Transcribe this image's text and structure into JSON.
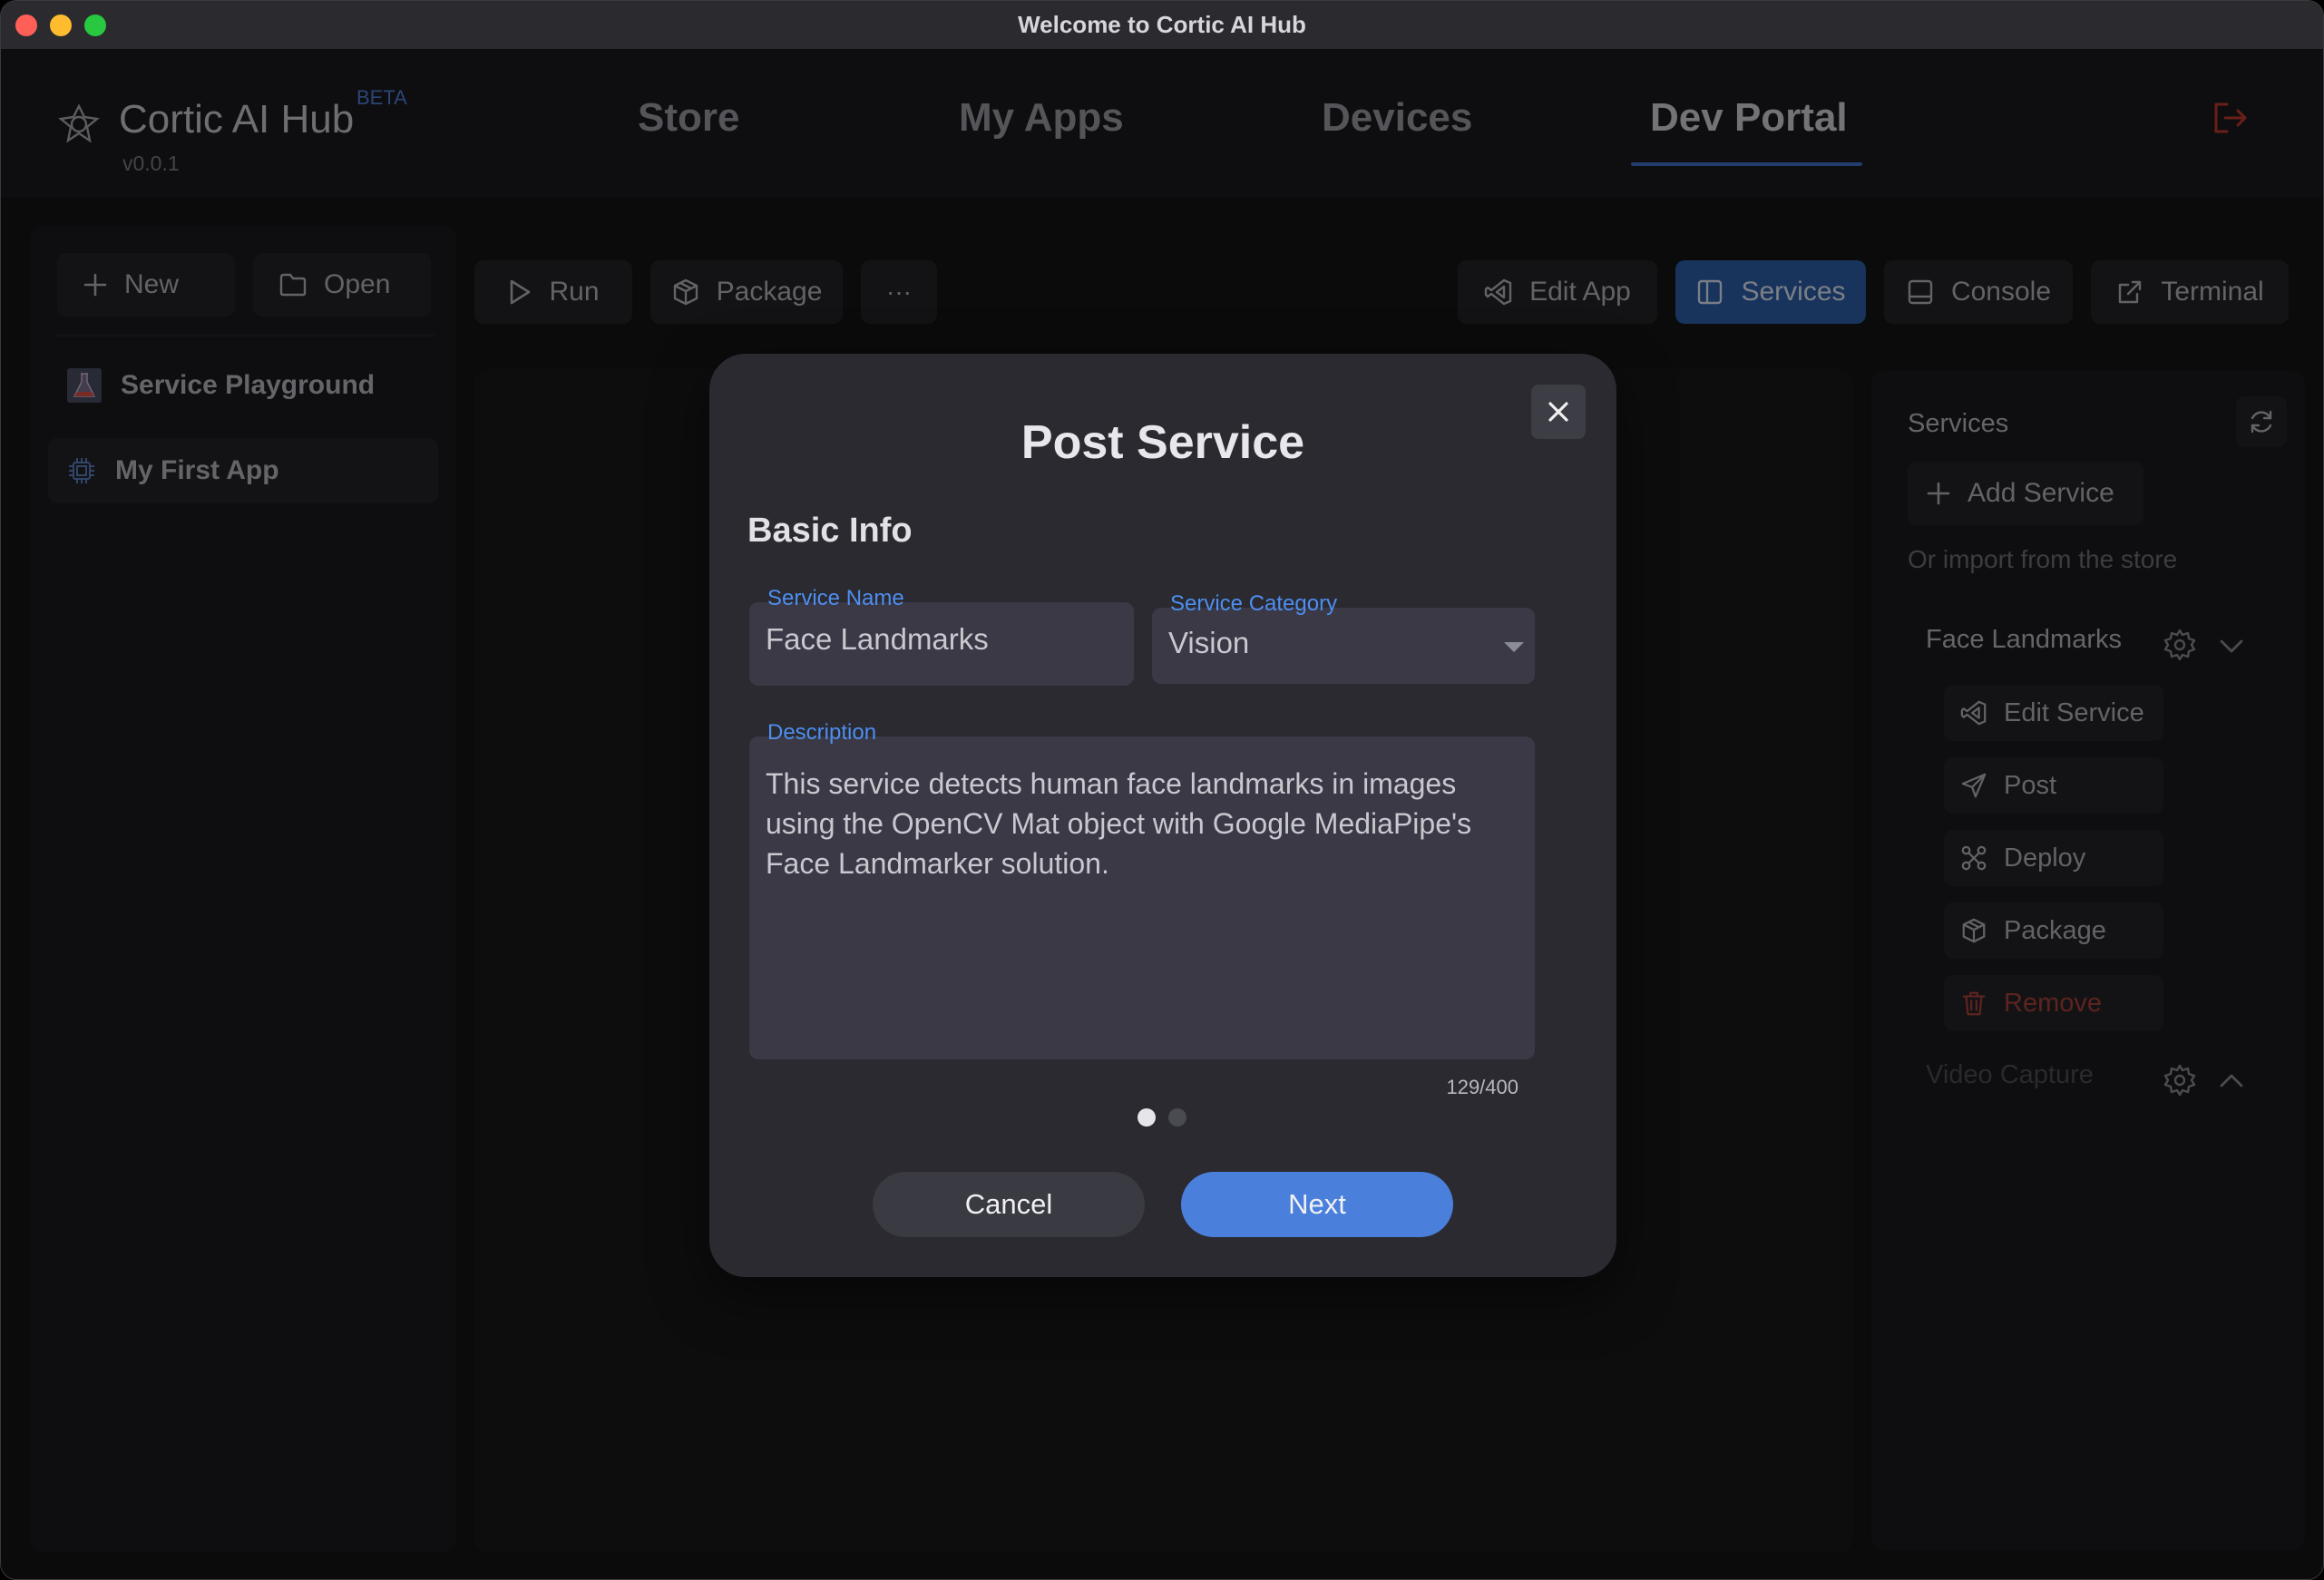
{
  "window": {
    "title": "Welcome to Cortic AI Hub"
  },
  "brand": {
    "name": "Cortic AI Hub",
    "badge": "BETA",
    "version": "v0.0.1"
  },
  "nav": {
    "store": "Store",
    "my_apps": "My Apps",
    "devices": "Devices",
    "dev_portal": "Dev Portal",
    "active": "Dev Portal"
  },
  "sidebar": {
    "new_label": "New",
    "open_label": "Open",
    "items": [
      {
        "label": "Service Playground",
        "icon": "flask-icon"
      },
      {
        "label": "My First App",
        "icon": "chip-icon",
        "selected": true
      }
    ]
  },
  "toolbar": {
    "run_label": "Run",
    "package_label": "Package",
    "more_label": "···",
    "edit_app_label": "Edit App",
    "services_label": "Services",
    "console_label": "Console",
    "terminal_label": "Terminal",
    "active": "Services"
  },
  "services_panel": {
    "title": "Services",
    "add_label": "Add Service",
    "import_hint": "Or import from the store",
    "services": [
      {
        "name": "Face Landmarks",
        "expanded": true,
        "actions": [
          "Edit Service",
          "Post",
          "Deploy",
          "Package",
          "Remove"
        ]
      },
      {
        "name": "Video Capture",
        "expanded": false
      }
    ]
  },
  "dialog": {
    "title": "Post Service",
    "section": "Basic Info",
    "service_name_label": "Service Name",
    "service_name_value": "Face Landmarks",
    "service_category_label": "Service Category",
    "service_category_value": "Vision",
    "description_label": "Description",
    "description_value": "This service detects human face landmarks in images using the OpenCV Mat object with Google MediaPipe's Face Landmarker solution.",
    "char_count": "129/400",
    "page_current": 1,
    "page_total": 2,
    "cancel_label": "Cancel",
    "next_label": "Next"
  },
  "colors": {
    "accent": "#4a7fdc",
    "active_tab": "#2d5ea8",
    "danger": "#a9413b",
    "logout": "#c0392b"
  }
}
